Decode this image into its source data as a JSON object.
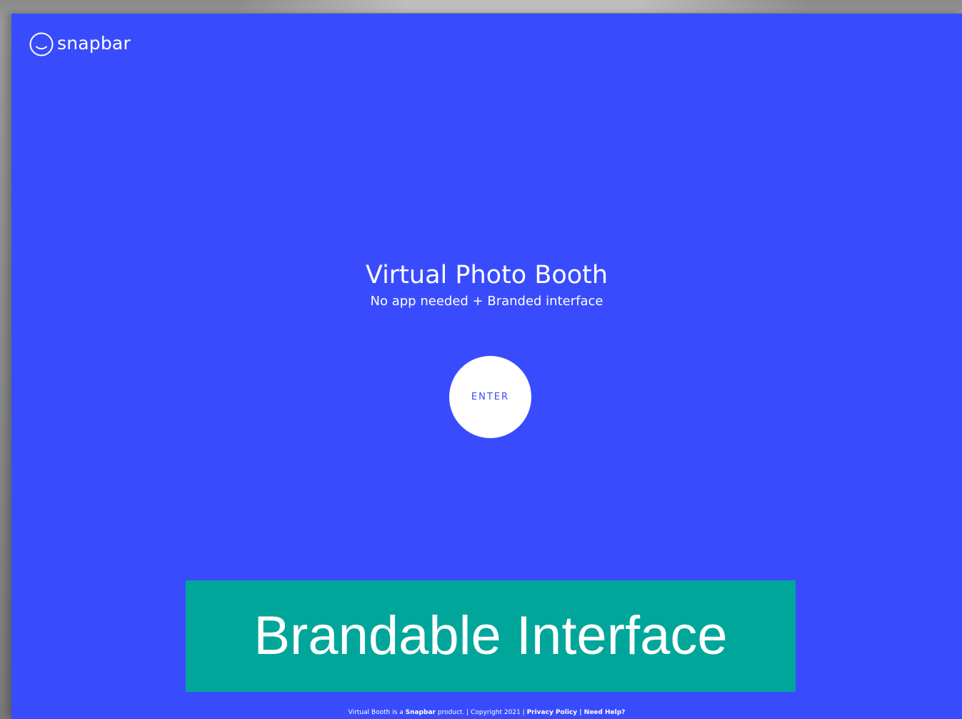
{
  "header": {
    "logo_text": "snapbar"
  },
  "hero": {
    "title": "Virtual Photo Booth",
    "subtitle": "No app needed + Branded interface"
  },
  "enter_button": {
    "label": "ENTER"
  },
  "banner": {
    "text": "Brandable Interface"
  },
  "footer": {
    "prefix": "Virtual Booth is a ",
    "brand": "Snapbar",
    "suffix": " product. | Copyright 2021 | ",
    "privacy_link": "Privacy Policy",
    "separator": " | ",
    "help_link": "Need Help?"
  },
  "colors": {
    "background": "#394cfd",
    "banner": "#00a69a",
    "text": "#ffffff"
  },
  "icons": {
    "logo": "snapbar-smile-circle-icon"
  }
}
